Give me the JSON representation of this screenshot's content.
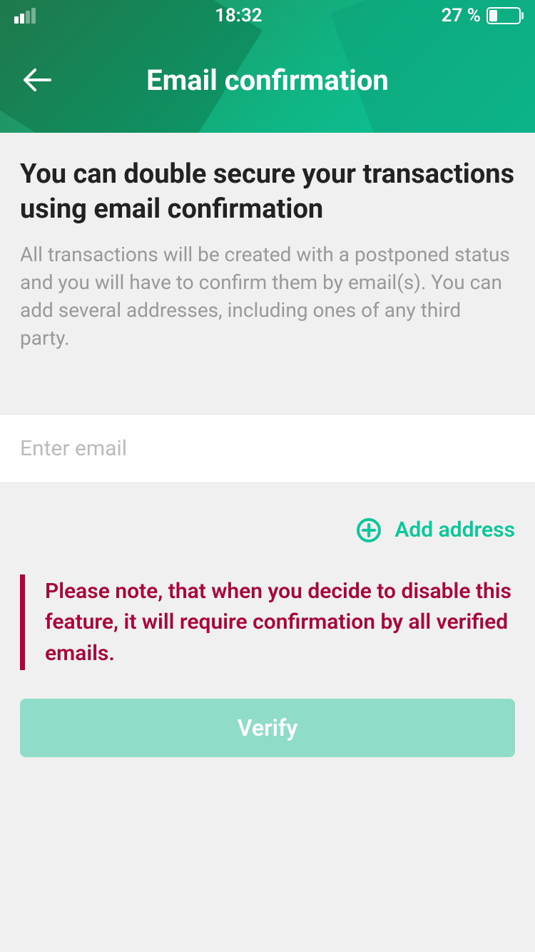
{
  "statusBar": {
    "time": "18:32",
    "batteryPercent": "27 %"
  },
  "header": {
    "title": "Email confirmation"
  },
  "content": {
    "heading": "You can double secure your transactions using email confirmation",
    "description": "All transactions will be created with a postponed status and you will have to confirm them by email(s). You can add several addresses, including ones of any third party."
  },
  "emailInput": {
    "placeholder": "Enter email",
    "value": ""
  },
  "addAddress": {
    "label": "Add address"
  },
  "note": {
    "text": "Please note, that when you decide to disable this feature, it will require confirmation by all verified emails."
  },
  "verifyButton": {
    "label": "Verify"
  },
  "colors": {
    "accent": "#0dc79a",
    "warning": "#a8073a",
    "verifyBg": "#8fddc9"
  }
}
